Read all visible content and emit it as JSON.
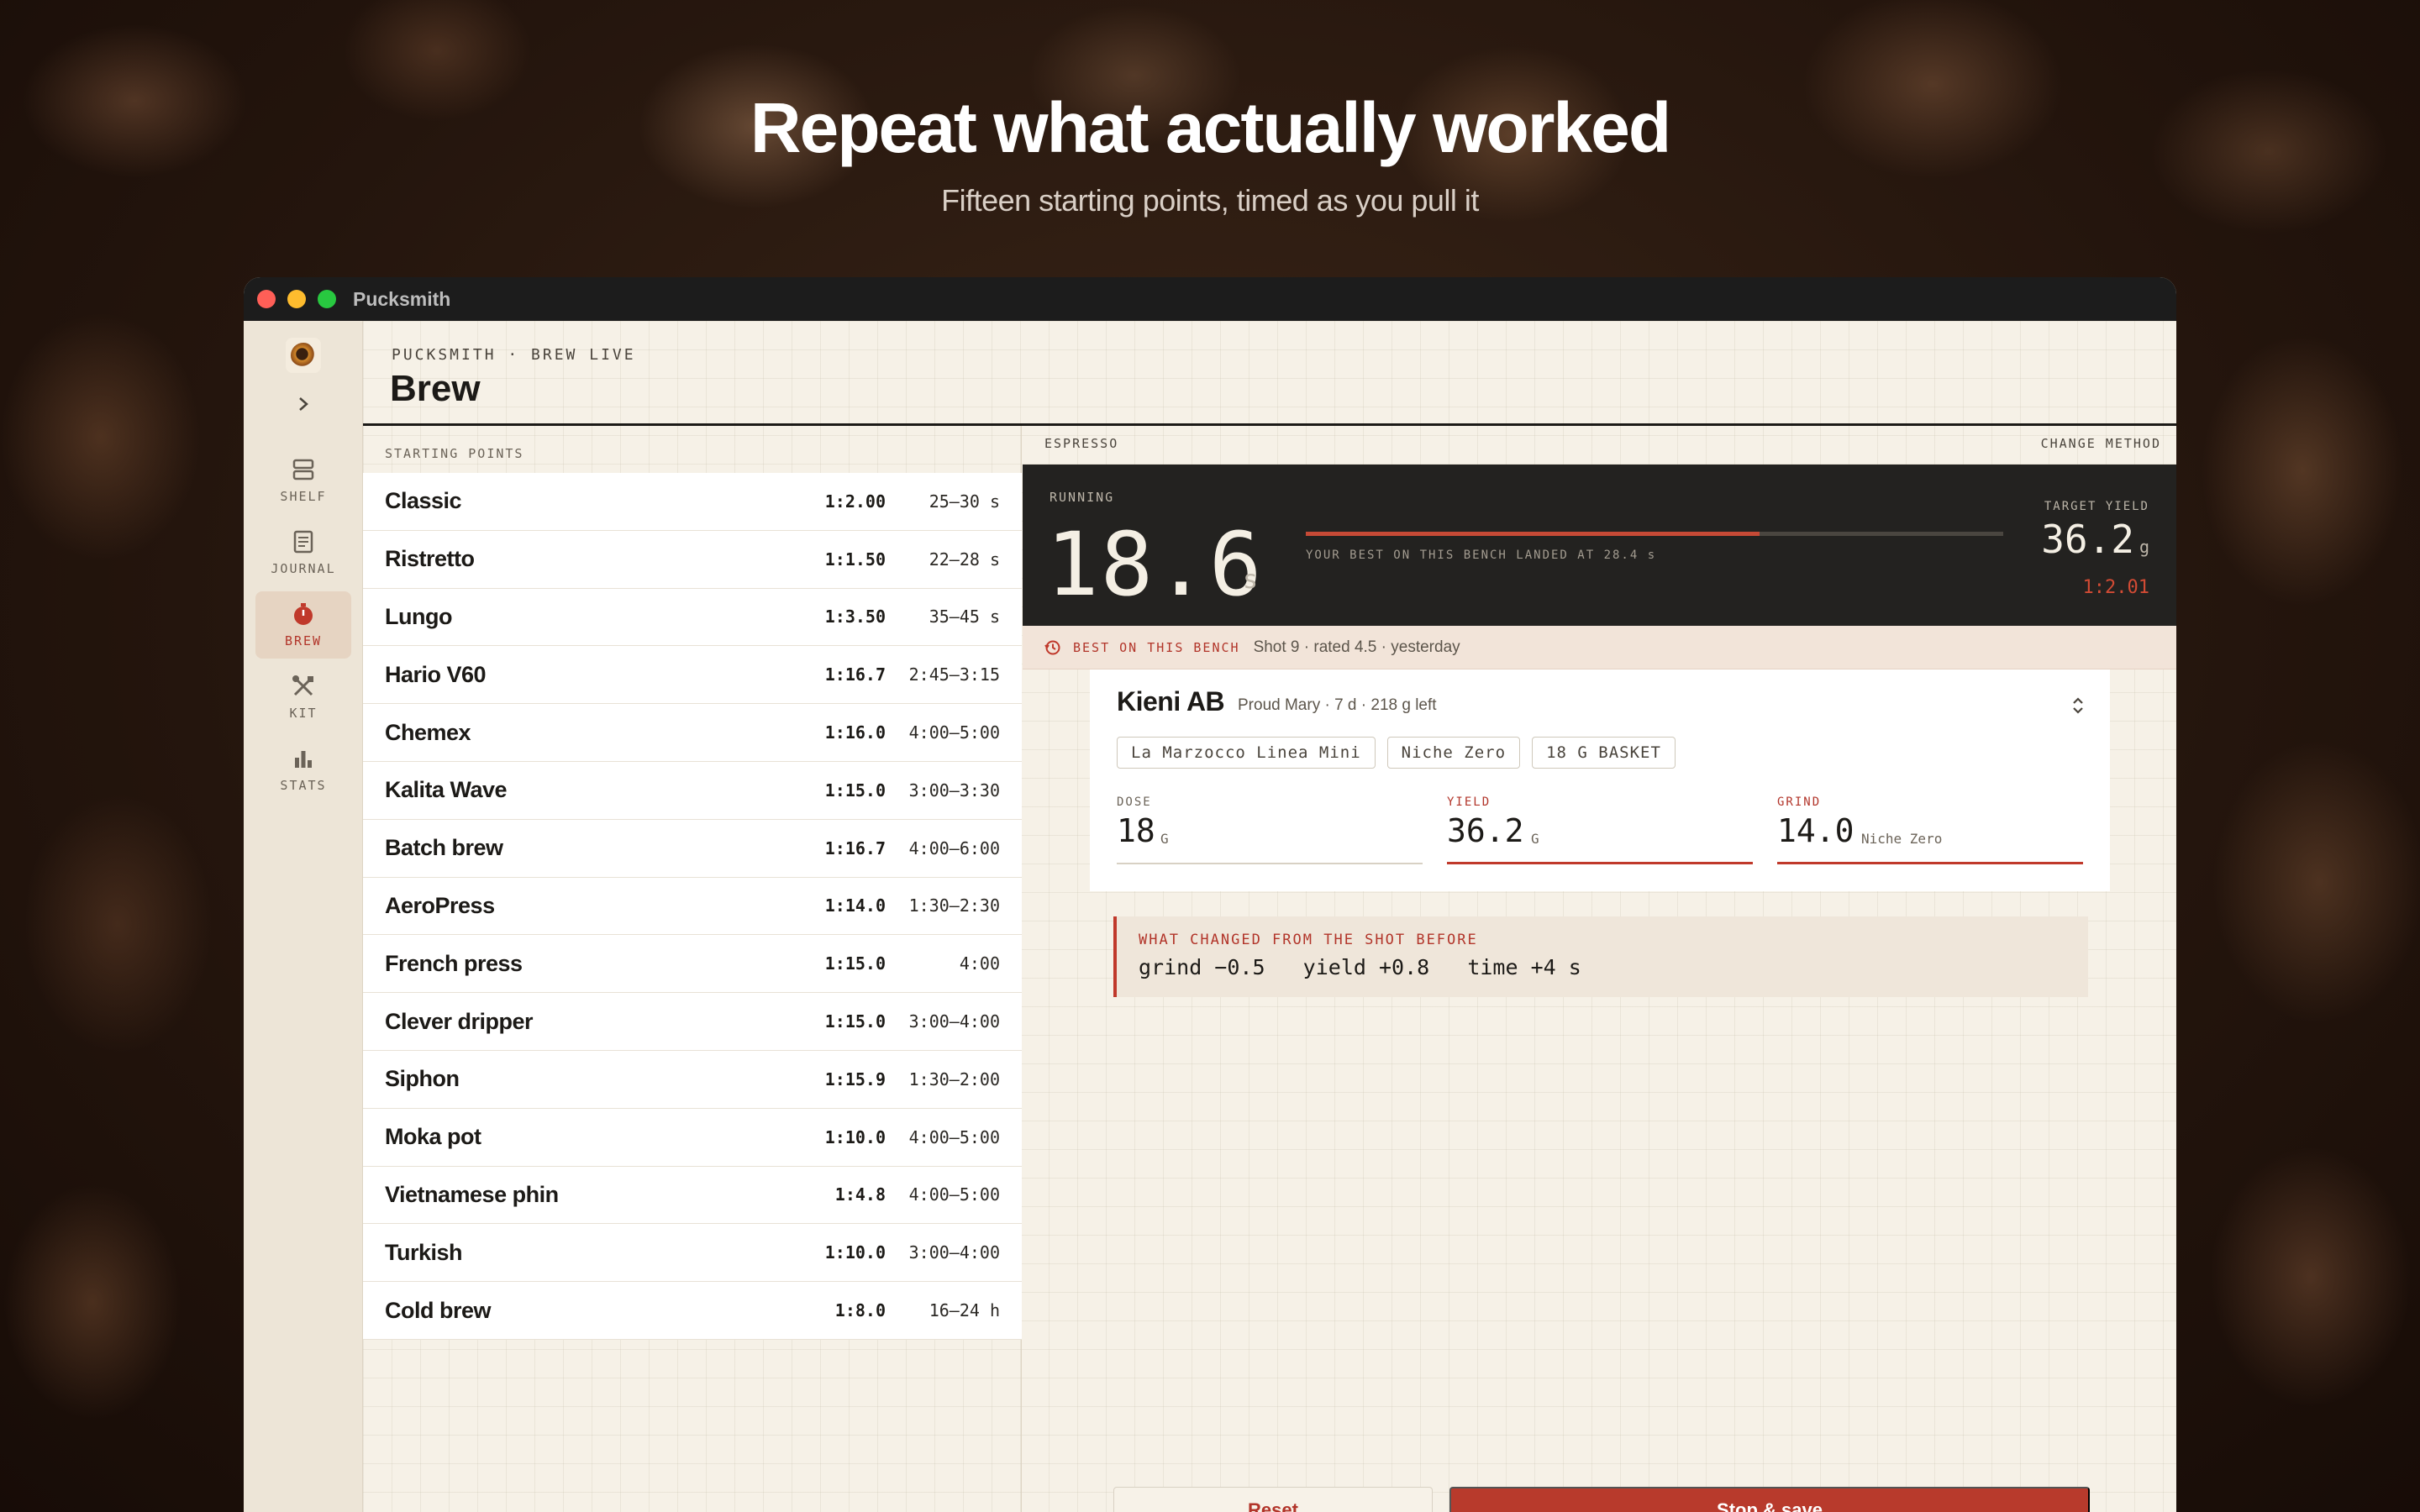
{
  "hero": {
    "headline": "Repeat what actually worked",
    "subline": "Fifteen starting points, timed as you pull it"
  },
  "window": {
    "title": "Pucksmith"
  },
  "sidebar": {
    "items": [
      {
        "label": "SHELF",
        "icon": "shelf-icon"
      },
      {
        "label": "JOURNAL",
        "icon": "journal-icon"
      },
      {
        "label": "BREW",
        "icon": "timer-icon",
        "active": true
      },
      {
        "label": "KIT",
        "icon": "tools-icon"
      },
      {
        "label": "STATS",
        "icon": "stats-icon"
      }
    ]
  },
  "header": {
    "eyebrow": "PUCKSMITH · BREW LIVE",
    "title": "Brew"
  },
  "starting_points": {
    "label": "STARTING POINTS",
    "methods": [
      {
        "name": "Classic",
        "ratio": "1:2.00",
        "time": "25–30 s"
      },
      {
        "name": "Ristretto",
        "ratio": "1:1.50",
        "time": "22–28 s"
      },
      {
        "name": "Lungo",
        "ratio": "1:3.50",
        "time": "35–45 s"
      },
      {
        "name": "Hario V60",
        "ratio": "1:16.7",
        "time": "2:45–3:15"
      },
      {
        "name": "Chemex",
        "ratio": "1:16.0",
        "time": "4:00–5:00"
      },
      {
        "name": "Kalita Wave",
        "ratio": "1:15.0",
        "time": "3:00–3:30"
      },
      {
        "name": "Batch brew",
        "ratio": "1:16.7",
        "time": "4:00–6:00"
      },
      {
        "name": "AeroPress",
        "ratio": "1:14.0",
        "time": "1:30–2:30"
      },
      {
        "name": "French press",
        "ratio": "1:15.0",
        "time": "4:00"
      },
      {
        "name": "Clever dripper",
        "ratio": "1:15.0",
        "time": "3:00–4:00"
      },
      {
        "name": "Siphon",
        "ratio": "1:15.9",
        "time": "1:30–2:00"
      },
      {
        "name": "Moka pot",
        "ratio": "1:10.0",
        "time": "4:00–5:00"
      },
      {
        "name": "Vietnamese phin",
        "ratio": "1:4.8",
        "time": "4:00–5:00"
      },
      {
        "name": "Turkish",
        "ratio": "1:10.0",
        "time": "3:00–4:00"
      },
      {
        "name": "Cold brew",
        "ratio": "1:8.0",
        "time": "16–24 h"
      }
    ]
  },
  "session": {
    "method_label": "ESPRESSO",
    "change_method": "CHANGE METHOD",
    "state": "RUNNING",
    "elapsed": "18.6",
    "elapsed_unit": "s",
    "progress": 0.65,
    "best_note": "YOUR BEST ON THIS BENCH LANDED AT 28.4 s",
    "target_label": "TARGET YIELD",
    "target_value": "36.2",
    "target_unit": "g",
    "target_ratio": "1:2.01"
  },
  "best": {
    "label": "BEST ON THIS BENCH",
    "detail": "Shot 9 · rated 4.5 · yesterday"
  },
  "bean": {
    "name": "Kieni AB",
    "meta": "Proud Mary · 7 d · 218 g left",
    "chips": [
      "La Marzocco Linea Mini",
      "Niche Zero",
      "18 G BASKET"
    ],
    "dose_label": "DOSE",
    "dose_value": "18",
    "dose_unit": "G",
    "yield_label": "YIELD",
    "yield_value": "36.2",
    "yield_unit": "G",
    "grind_label": "GRIND",
    "grind_value": "14.0",
    "grind_unit": "Niche Zero"
  },
  "changes": {
    "label": "WHAT CHANGED FROM THE SHOT BEFORE",
    "body": "grind −0.5   yield +0.8   time +4 s"
  },
  "actions": {
    "reset": "Reset",
    "save": "Stop & save"
  },
  "colors": {
    "accent": "#b83a2c",
    "panel_dark": "#232220",
    "paper": "#f6f1e7"
  }
}
